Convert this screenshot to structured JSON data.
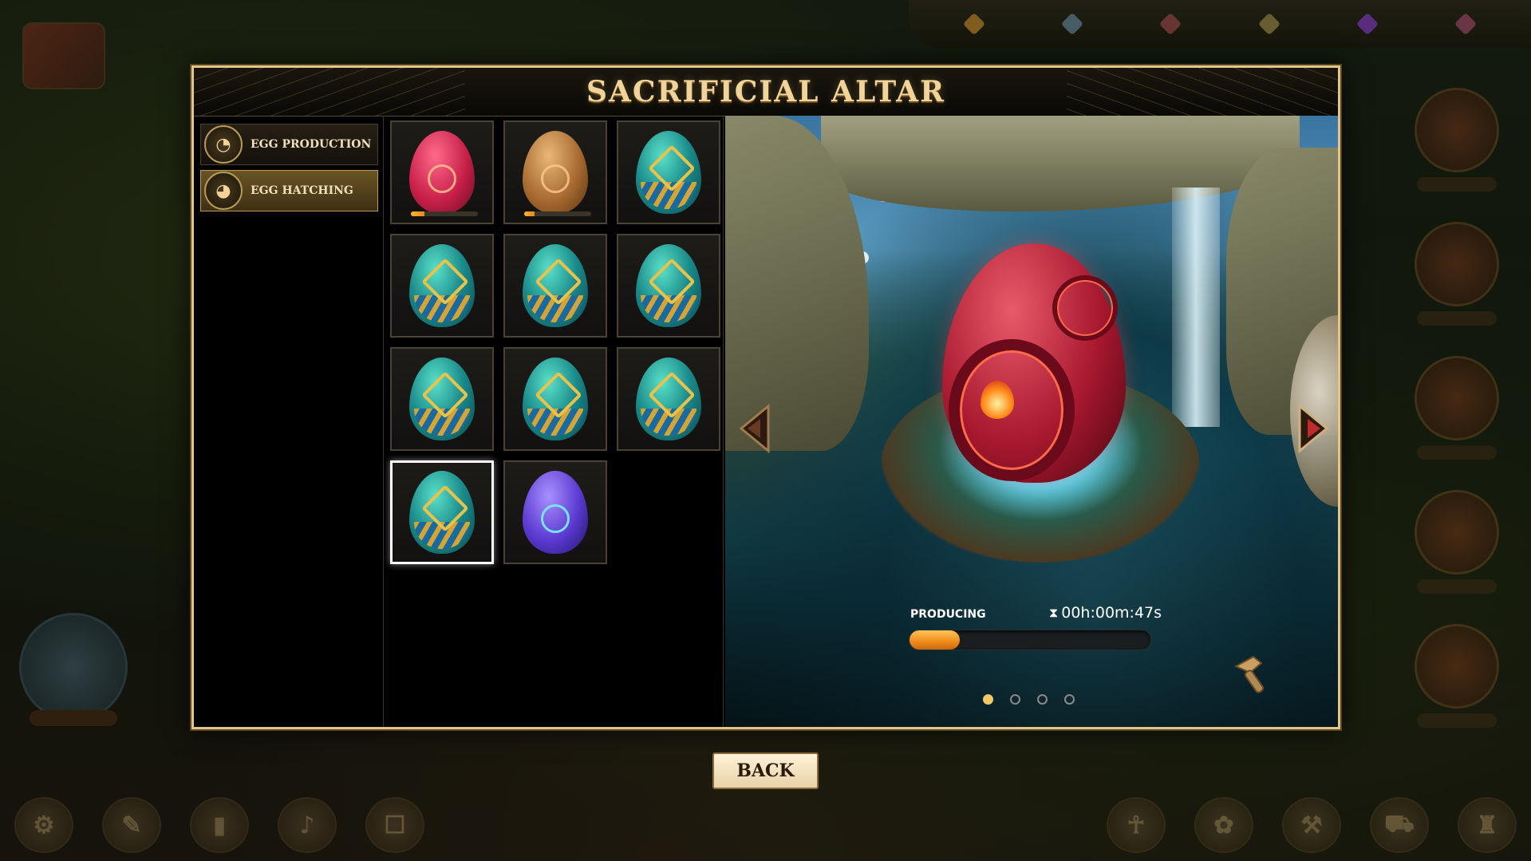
{
  "panel": {
    "title": "SACRIFICIAL ALTAR",
    "tabs": [
      {
        "label": "EGG PRODUCTION",
        "icon": "egg-production-icon",
        "active": false
      },
      {
        "label": "EGG HATCHING",
        "icon": "egg-hatching-icon",
        "active": true
      }
    ],
    "eggs": [
      {
        "type": "red",
        "progress": 0.2
      },
      {
        "type": "brown",
        "progress": 0.15
      },
      {
        "type": "green"
      },
      {
        "type": "green"
      },
      {
        "type": "green"
      },
      {
        "type": "green"
      },
      {
        "type": "green"
      },
      {
        "type": "green"
      },
      {
        "type": "green"
      },
      {
        "type": "green",
        "selected": true
      },
      {
        "type": "purple"
      }
    ],
    "viewer": {
      "status_label": "PRODUCING",
      "timer": "00h:00m:47s",
      "progress": 0.21,
      "page_count": 4,
      "active_page": 1
    },
    "back_label": "BACK"
  },
  "colors": {
    "gold": "#e0c68a",
    "progress_orange": "#f08a1a",
    "tab_active": "#6a5426"
  }
}
